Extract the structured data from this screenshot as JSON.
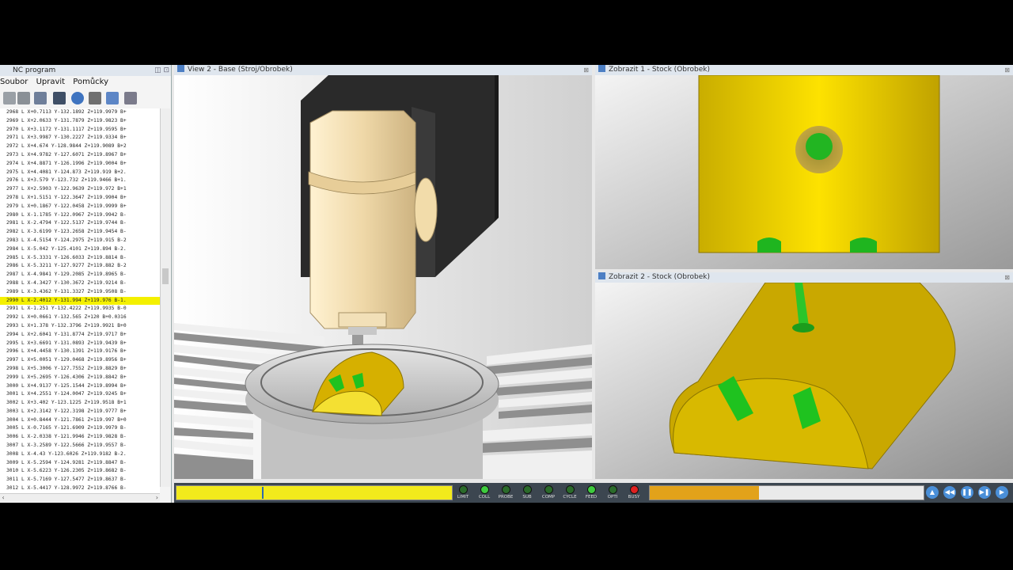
{
  "nc_panel": {
    "title": "NC program",
    "menu": [
      "Soubor",
      "Upravit",
      "Pomůcky"
    ],
    "lines": [
      "2968 L  X+0.7113 Y-132.1892 Z+119.9979 B+",
      "2969 L  X+2.0633 Y-131.7879 Z+119.9823 B+",
      "2970 L  X+3.1172 Y-131.1117 Z+119.9595 B+",
      "2971 L  X+3.9987 Y-130.2227 Z+119.9334 B+",
      "2972 L  X+4.674 Y-128.9844 Z+119.9089 B+2",
      "2973 L  X+4.9782 Y-127.6071 Z+119.8967 B+",
      "2974 L  X+4.8871 Y-126.1996 Z+119.9004 B+",
      "2975 L  X+4.4081 Y-124.873 Z+119.919 B+2.",
      "2976 L  X+3.579 Y-123.732 Z+119.9466 B+1.",
      "2977 L  X+2.5903 Y-122.9639 Z+119.972 B+1",
      "2978 L  X+1.5151 Y-122.3647 Z+119.9904 B+",
      "2979 L  X+0.1867 Y-122.0458 Z+119.9999 B+",
      "2980 L  X-1.1785 Y-122.0967 Z+119.9942 B-",
      "2981 L  X-2.4794 Y-122.5137 Z+119.9744 B-",
      "2982 L  X-3.6199 Y-123.2658 Z+119.9454 B-",
      "2983 L  X-4.5154 Y-124.2975 Z+119.915 B-2",
      "2984 L  X-5.042 Y-125.4101 Z+119.894 B-2.",
      "2985 L  X-5.3331 Y-126.6033 Z+119.8814 B-",
      "2986 L  X-5.3211 Y-127.9277 Z+119.882 B-2",
      "2987 L  X-4.9841 Y-129.2085 Z+119.8965 B-",
      "2988 L  X-4.3427 Y-130.3672 Z+119.9214 B-",
      "2989 L  X-3.4362 Y-131.3327 Z+119.9508 B-",
      "2990 L  X-2.4012 Y-131.994 Z+119.976 B-1.",
      "2991 L  X-1.251 Y-132.4222 Z+119.9935 B-0",
      "2992 L  X+0.0661 Y-132.565 Z+120 B+0.0316",
      "2993 L  X+1.378 Y-132.3796 Z+119.9921 B+0",
      "2994 L  X+2.6041 Y-131.8774 Z+119.9717 B+",
      "2995 L  X+3.6691 Y-131.0893 Z+119.9439 B+",
      "2996 L  X+4.4458 Y-130.1391 Z+119.9176 B+",
      "2997 L  X+5.0051 Y-129.0468 Z+119.8956 B+",
      "2998 L  X+5.3006 Y-127.7552 Z+119.8829 B+",
      "2999 L  X+5.2695 Y-126.4306 Z+119.8842 B+",
      "3000 L  X+4.9137 Y-125.1544 Z+119.8994 B+",
      "3001 L  X+4.2551 Y-124.0047 Z+119.9245 B+",
      "3002 L  X+3.402 Y-123.1225 Z+119.9518 B+1",
      "3003 L  X+2.3142 Y-122.3198 Z+119.9777 B+",
      "3004 L  X+0.8444 Y-121.7861 Z+119.997 B+0",
      "3005 L  X-0.7165 Y-121.6909 Z+119.9979 B-",
      "3006 L  X-2.0338 Y-121.9946 Z+119.9828 B-",
      "3007 L  X-3.2589 Y-122.5666 Z+119.9557 B-",
      "3008 L  X-4.43 Y-123.6026 Z+119.9182 B-2.",
      "3009 L  X-5.2594 Y-124.9281 Z+119.8847 B-",
      "3010 L  X-5.6223 Y-126.2305 Z+119.8682 B-",
      "3011 L  X-5.7169 Y-127.5477 Z+119.8637 B-",
      "3012 L  X-5.4417 Y-128.9972 Z+119.8766 B-"
    ],
    "highlighted_index": 22
  },
  "views": {
    "main": "View 2 - Base (Stroj/Obrobek)",
    "top_right": "Zobrazit 1 - Stock (Obrobek)",
    "bottom_right": "Zobrazit 2 - Stock (Obrobek)"
  },
  "status": {
    "labels": [
      "LIMIT",
      "COLL",
      "PROBE",
      "SUB",
      "COMP",
      "CYCLE",
      "FEED",
      "OPTI",
      "BUSY"
    ],
    "colors": [
      "#2b6b2b",
      "#3ecb3e",
      "#2b6b2b",
      "#2b6b2b",
      "#2b6b2b",
      "#2b6b2b",
      "#3ecb3e",
      "#2b6b2b",
      "#e02020"
    ]
  },
  "progress": {
    "position": 0.31,
    "speed": 0.4
  },
  "colors": {
    "workpiece": "#d4b800",
    "cut": "#1db51d",
    "head": "#f0dcb0"
  }
}
